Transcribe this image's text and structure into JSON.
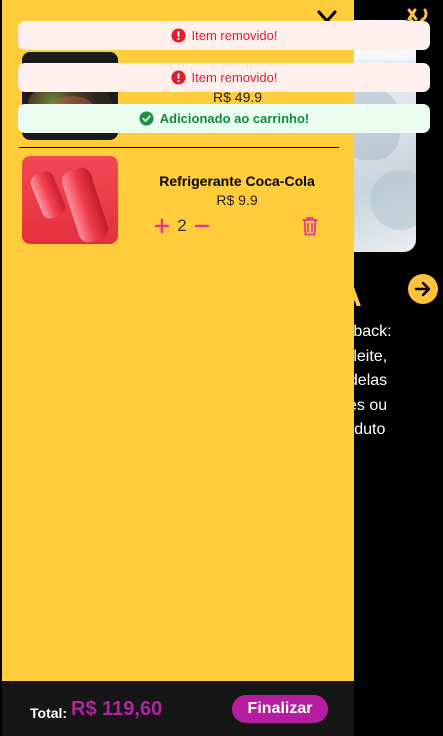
{
  "background": {
    "title_fragment": "A",
    "description_lines": [
      "utback:",
      "e leite,",
      "odelas",
      "zes ou",
      "roduto"
    ],
    "icons": {
      "top_right": "fork-knife-icon",
      "next": "arrow-right-icon"
    }
  },
  "cart": {
    "items": [
      {
        "name": "",
        "price": "R$ 49.9",
        "image_icon": "food-plate-image"
      },
      {
        "name": "Refrigerante Coca-Cola",
        "price": "R$ 9.9",
        "quantity": "2",
        "image_icon": "coca-cola-cans-image"
      }
    ],
    "icons": {
      "close": "chevron-down-icon",
      "plus": "plus-icon",
      "minus": "minus-icon",
      "delete": "trash-icon"
    }
  },
  "footer": {
    "total_label": "Total:",
    "total_value": "R$ 119,60",
    "checkout_label": "Finalizar"
  },
  "toasts": [
    {
      "text": "Item removido!",
      "type": "error",
      "icon": "exclamation-circle-icon"
    },
    {
      "text": "Item removido!",
      "type": "error",
      "icon": "exclamation-circle-icon"
    },
    {
      "text": "Adicionado ao carrinho!",
      "type": "success",
      "icon": "check-circle-icon"
    }
  ],
  "colors": {
    "drawer": "#ffcd3c",
    "accent": "#b41d9d",
    "qty_controls": "#e8368f",
    "error": "#e31b2f",
    "success": "#118a3a"
  }
}
